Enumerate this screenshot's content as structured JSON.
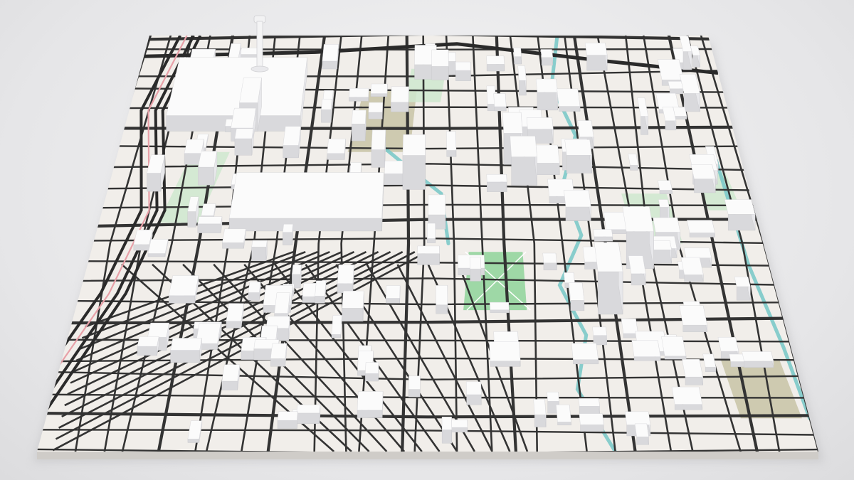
{
  "scene": {
    "kind": "3D printed city street-map model",
    "colors": {
      "background": "#e9e9ea",
      "base": "#f1eeea",
      "base_edge": "#c9c6c2",
      "roads": "#333333",
      "highway": "#2a2a2a",
      "buildings": "#fbfbfb",
      "building_shade": "#d9d9dc",
      "park": "#cfe8cf",
      "plaza": "#8fd39a",
      "lot": "#c8c3a6",
      "river": "#7cc9c9",
      "highway_accent": "#e8a0a8"
    },
    "icons": [
      "tower-icon",
      "plaza-icon",
      "river-icon"
    ]
  }
}
